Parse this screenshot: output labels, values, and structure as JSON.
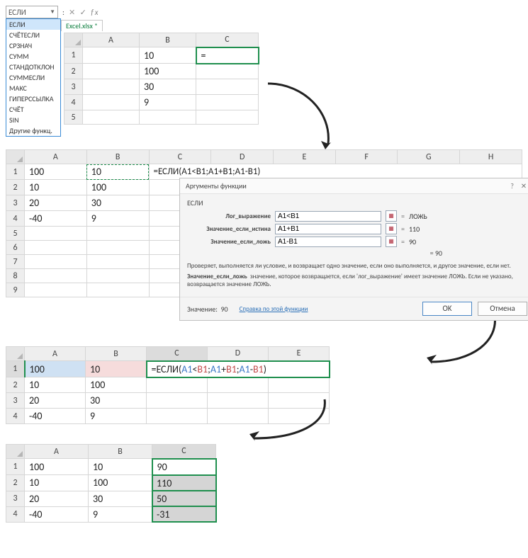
{
  "block1": {
    "namebox_value": "ЕСЛИ",
    "tab_label": "Excel.xlsx *",
    "fx_cancel": "✕",
    "fx_accept": "✓",
    "fx_label": "fx",
    "dropdown": [
      "ЕСЛИ",
      "СЧЁТЕСЛИ",
      "СРЗНАЧ",
      "СУММ",
      "СТАНДОТКЛОН",
      "СУММЕСЛИ",
      "МАКС",
      "ГИПЕРССЫЛКА",
      "СЧЁТ",
      "SIN",
      "Другие функц."
    ],
    "cols": [
      "A",
      "B",
      "C"
    ],
    "rows": [
      {
        "n": "1",
        "A": "",
        "B": "10",
        "C": "="
      },
      {
        "n": "2",
        "A": "",
        "B": "100",
        "C": ""
      },
      {
        "n": "3",
        "A": "",
        "B": "30",
        "C": ""
      },
      {
        "n": "4",
        "A": "",
        "B": "9",
        "C": ""
      },
      {
        "n": "5",
        "A": "",
        "B": "",
        "C": ""
      }
    ]
  },
  "block2": {
    "cols": [
      "A",
      "B",
      "C",
      "D",
      "E",
      "F",
      "G",
      "H"
    ],
    "rows": [
      {
        "n": "1",
        "A": "100",
        "B": "10",
        "C_formula": "=ЕСЛИ(A1<B1;A1+B1;A1-B1)"
      },
      {
        "n": "2",
        "A": "10",
        "B": "100"
      },
      {
        "n": "3",
        "A": "20",
        "B": "30"
      },
      {
        "n": "4",
        "A": "-40",
        "B": "9"
      },
      {
        "n": "5"
      },
      {
        "n": "6"
      },
      {
        "n": "7"
      },
      {
        "n": "8"
      },
      {
        "n": "9"
      }
    ],
    "dialog": {
      "title": "Аргументы функции",
      "help_icon": "?",
      "close_icon": "✕",
      "fn_name": "ЕСЛИ",
      "args": [
        {
          "label": "Лог_выражение",
          "value": "A1<B1",
          "result": "ЛОЖЬ"
        },
        {
          "label": "Значение_если_истина",
          "value": "A1+B1",
          "result": "110"
        },
        {
          "label": "Значение_если_ложь",
          "value": "A1-B1",
          "result": "90"
        }
      ],
      "overall_eq": "=",
      "overall_result": "90",
      "desc1": "Проверяет, выполняется ли условие, и возвращает одно значение, если оно выполняется, и другое значение, если нет.",
      "desc2_label": "Значение_если_ложь",
      "desc2_text": "значение, которое возвращается, если 'лог_выражение' имеет значение ЛОЖЬ. Если не указано, возвращается значение ЛОЖЬ.",
      "value_label": "Значение:",
      "value_result": "90",
      "help_link": "Справка по этой функции",
      "ok": "OK",
      "cancel": "Отмена"
    }
  },
  "block3": {
    "cols": [
      "A",
      "B",
      "C",
      "D",
      "E"
    ],
    "formula_prefix": "=ЕСЛИ(",
    "f_a1": "A1",
    "f_lt": "<",
    "f_b1": "B1",
    "sep": ";",
    "f_a1p": "A1",
    "plus": "+",
    "f_b1p": "B1",
    "f_a1m": "A1",
    "minus": "-",
    "f_b1m": "B1",
    "close": ")",
    "rows": [
      {
        "n": "1",
        "A": "100",
        "B": "10"
      },
      {
        "n": "2",
        "A": "10",
        "B": "100"
      },
      {
        "n": "3",
        "A": "20",
        "B": "30"
      },
      {
        "n": "4",
        "A": "-40",
        "B": "9"
      }
    ]
  },
  "block4": {
    "cols": [
      "A",
      "B",
      "C"
    ],
    "rows": [
      {
        "n": "1",
        "A": "100",
        "B": "10",
        "C": "90"
      },
      {
        "n": "2",
        "A": "10",
        "B": "100",
        "C": "110"
      },
      {
        "n": "3",
        "A": "20",
        "B": "30",
        "C": "50"
      },
      {
        "n": "4",
        "A": "-40",
        "B": "9",
        "C": "-31"
      }
    ]
  }
}
